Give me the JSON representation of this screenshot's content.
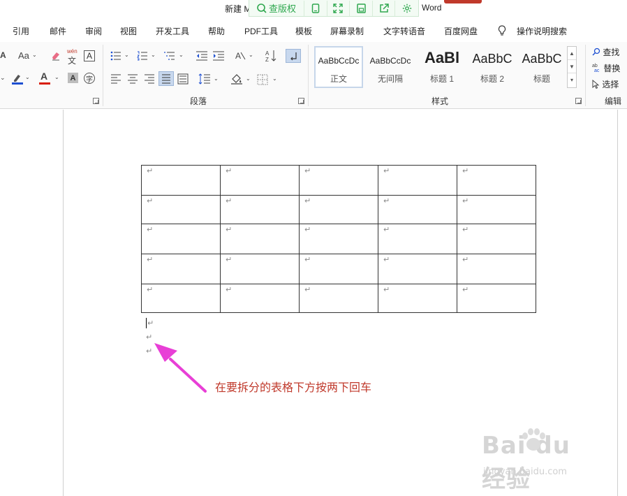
{
  "title_bar": {
    "title": "新建 M",
    "app_name": "Word",
    "float_toolbar": {
      "main_label": "查版权",
      "icons": [
        "phone-frame-icon",
        "expand-icon",
        "save-icon",
        "share-icon",
        "settings-icon"
      ],
      "accent": "#2fa84f"
    }
  },
  "menu_tabs": [
    "引用",
    "邮件",
    "审阅",
    "视图",
    "开发工具",
    "帮助",
    "PDF工具",
    "模板",
    "屏幕录制",
    "文字转语音",
    "百度网盘"
  ],
  "tell_me": "操作说明搜索",
  "ribbon": {
    "font_group": {
      "grow_font": "A",
      "case_button": "Aa",
      "phonetic": "wén",
      "phonetic_char": "文",
      "char_border": "A",
      "font_color_letter": "A",
      "shade_letter": "A",
      "enclose_char": "字",
      "highlight_color": "#1d4fd1",
      "font_color": "#d81e06"
    },
    "paragraph_group": {
      "label": "段落"
    },
    "styles_group": {
      "label": "样式",
      "styles": [
        {
          "sample": "AaBbCcDc",
          "name": "正文",
          "selected": true
        },
        {
          "sample": "AaBbCcDc",
          "name": "无间隔",
          "selected": false
        },
        {
          "sample": "AaBl",
          "name": "标题 1",
          "selected": false
        },
        {
          "sample": "AaBbC",
          "name": "标题 2",
          "selected": false
        },
        {
          "sample": "AaBbC",
          "name": "标题",
          "selected": false
        }
      ]
    },
    "edit_group": {
      "label": "编辑",
      "find": "查找",
      "replace": "替换",
      "select": "选择"
    }
  },
  "document": {
    "table": {
      "rows": 5,
      "cols": 5,
      "cell_mark": "↵"
    },
    "paragraph_marks": [
      "↵",
      "↵",
      "↵"
    ],
    "annotation": "在要拆分的表格下方按两下回车",
    "annotation_color": "#c0392b",
    "arrow_color": "#e83fd6"
  },
  "watermark": {
    "brand": "Bai du 经验",
    "url": "jingyan.baidu.com"
  }
}
